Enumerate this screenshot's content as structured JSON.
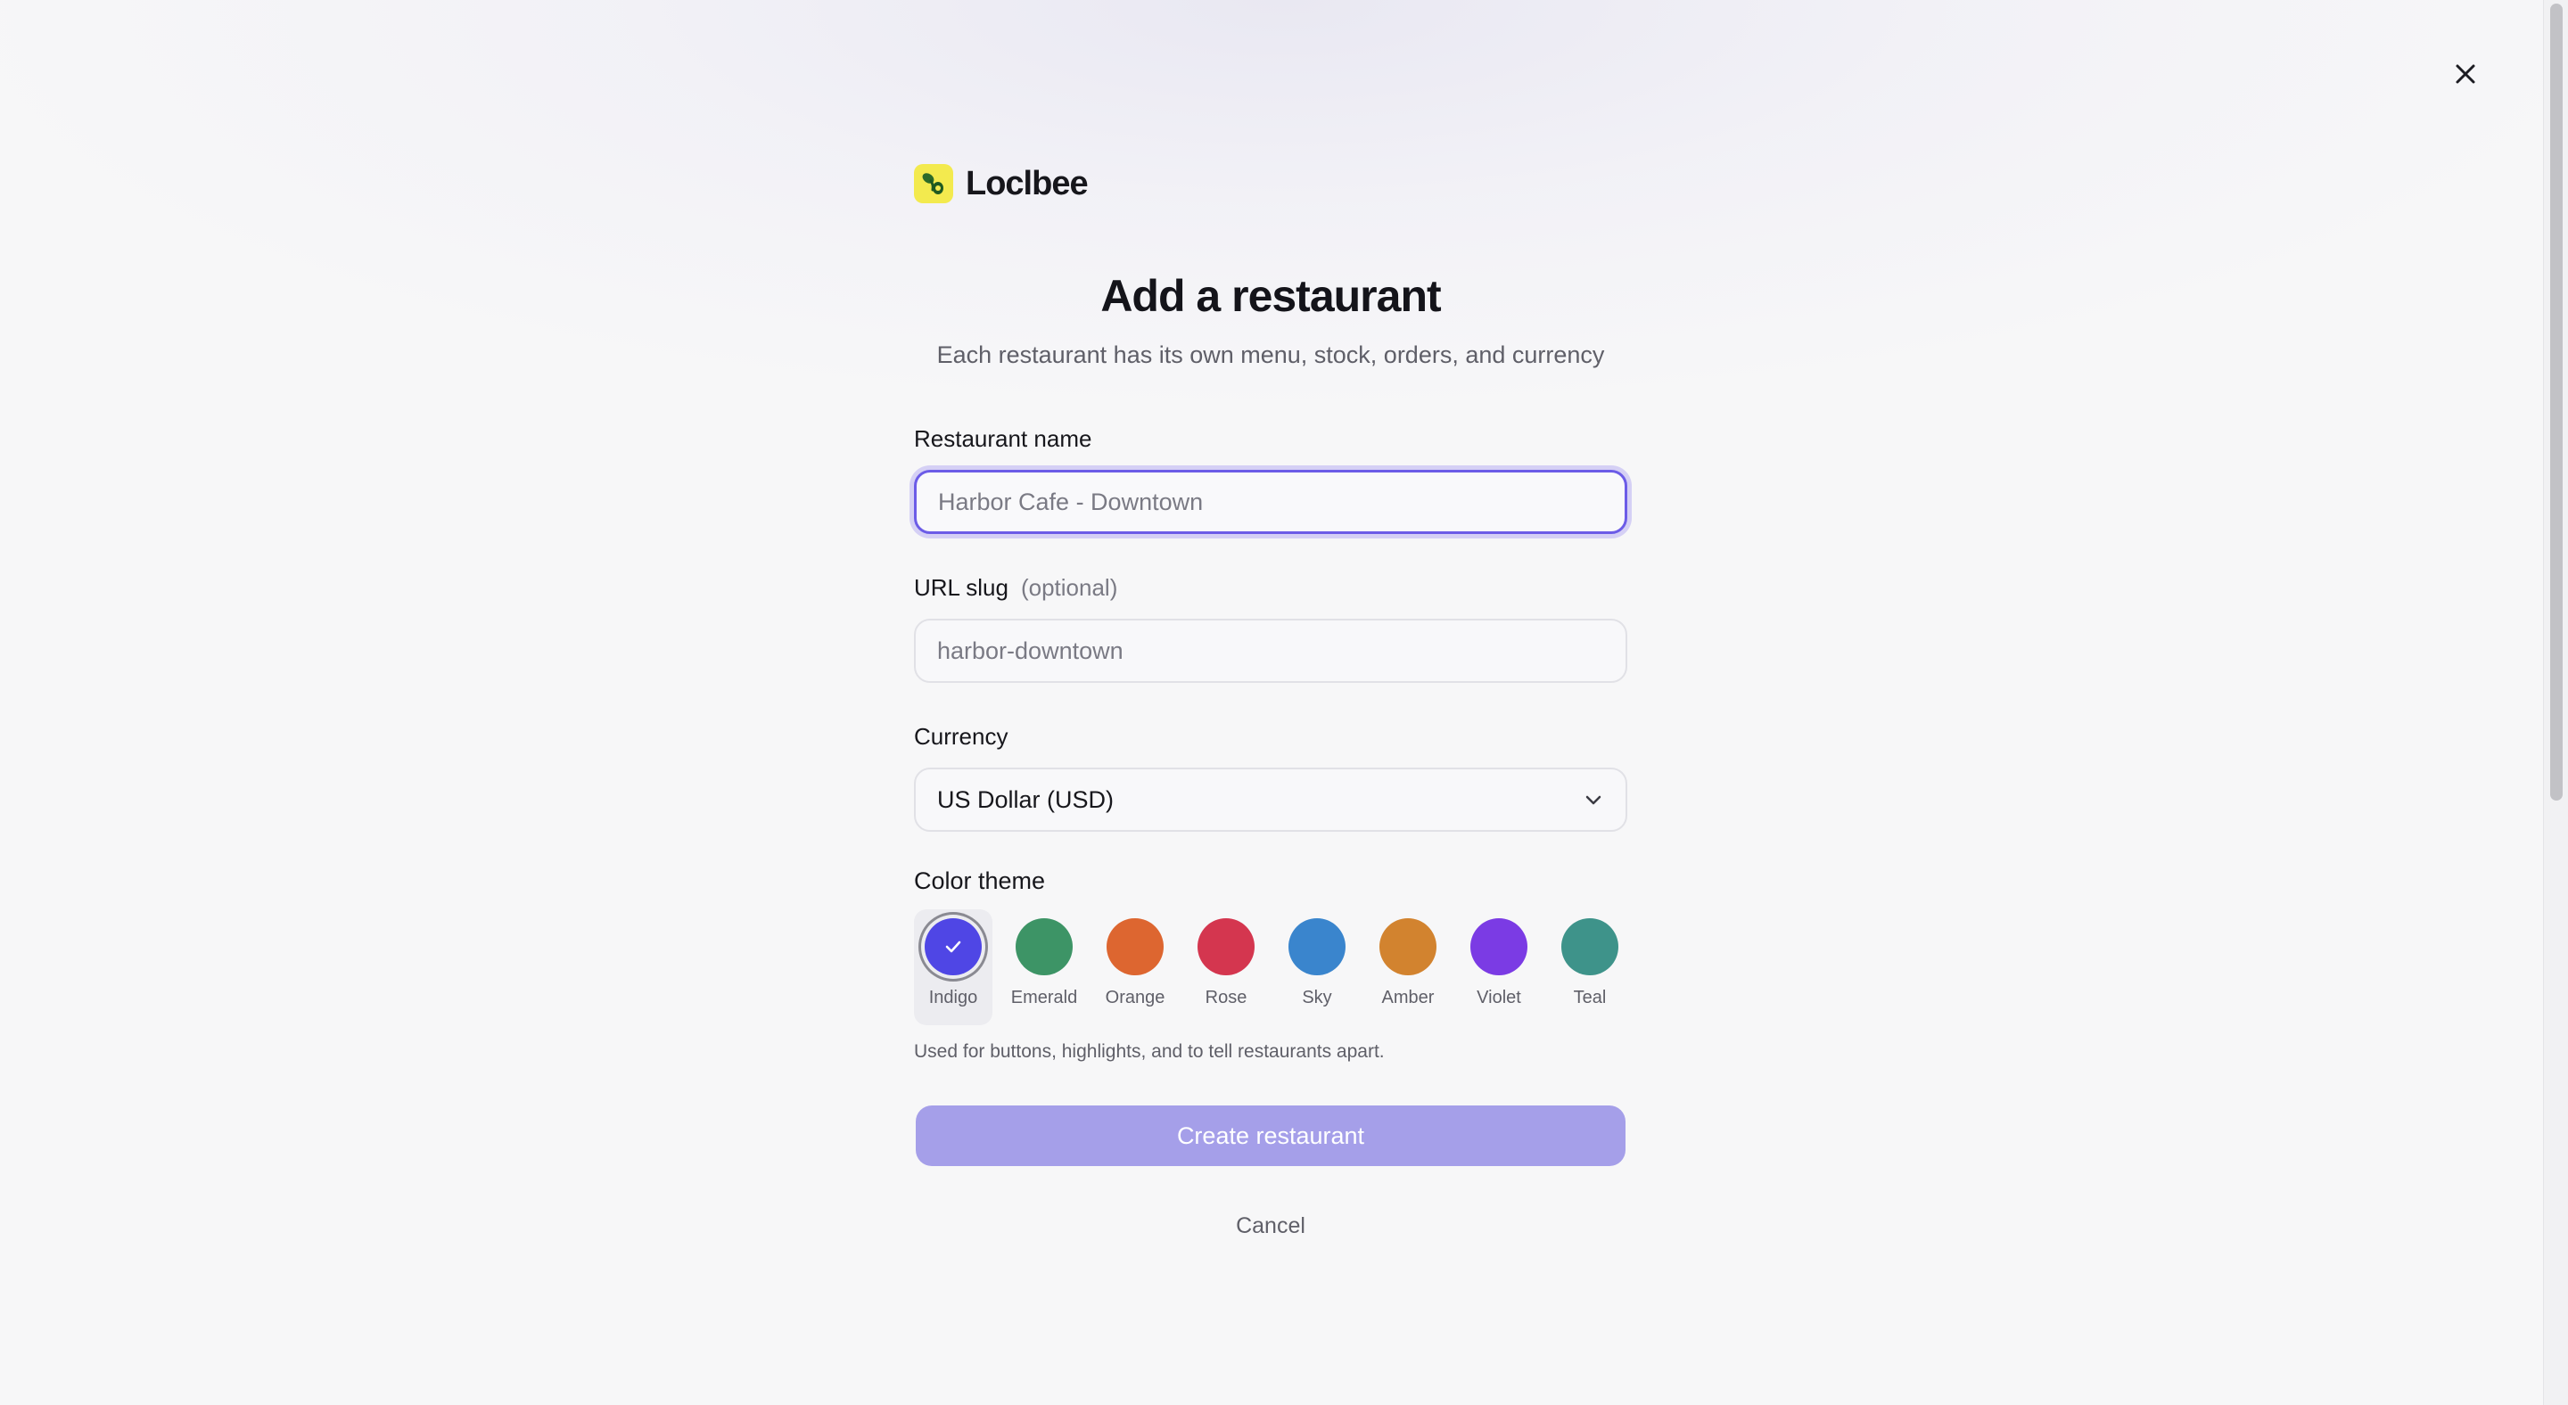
{
  "brand": {
    "name": "Loclbee",
    "logo_icon": "bee-logo-icon",
    "logo_color": "#f3ea4e"
  },
  "close": {
    "icon": "close-icon"
  },
  "header": {
    "title": "Add a restaurant",
    "subtitle": "Each restaurant has its own menu, stock, orders, and currency"
  },
  "fields": {
    "name": {
      "label": "Restaurant name",
      "value": "",
      "placeholder": "Harbor Cafe - Downtown"
    },
    "slug": {
      "label": "URL slug",
      "optional": "(optional)",
      "value": "",
      "placeholder": "harbor-downtown"
    },
    "currency": {
      "label": "Currency",
      "value": "US Dollar (USD)",
      "icon": "chevron-down-icon"
    }
  },
  "theme": {
    "label": "Color theme",
    "selected": "Indigo",
    "options": [
      {
        "label": "Indigo",
        "color": "#4f46e5"
      },
      {
        "label": "Emerald",
        "color": "#3d9466"
      },
      {
        "label": "Orange",
        "color": "#dd6630"
      },
      {
        "label": "Rose",
        "color": "#d4364f"
      },
      {
        "label": "Sky",
        "color": "#3a85cd"
      },
      {
        "label": "Amber",
        "color": "#d2832f"
      },
      {
        "label": "Violet",
        "color": "#7b3be4"
      },
      {
        "label": "Teal",
        "color": "#3e938a"
      }
    ],
    "help": "Used for buttons, highlights, and to tell restaurants apart."
  },
  "actions": {
    "create_label": "Create restaurant",
    "create_color": "#a59fe9",
    "cancel_label": "Cancel"
  }
}
